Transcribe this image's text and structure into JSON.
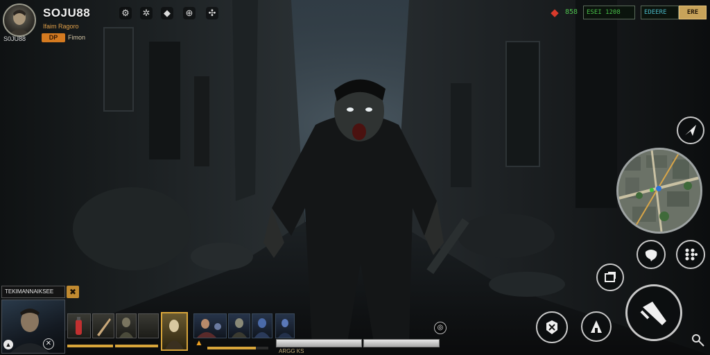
{
  "player": {
    "name": "SOJU88",
    "tag": "S0JU88",
    "subtitle": "Ifaim Ragoro",
    "badge": "DP",
    "badge_text": "Fimon",
    "avatar_icon": "survivor-portrait"
  },
  "top_icons": [
    "settings-icon",
    "gear-icon",
    "chat-icon",
    "crosshair-icon",
    "inventory-icon"
  ],
  "resources": {
    "icon": "gem-icon",
    "value": "858",
    "status_1": "ESEI 1208",
    "status_2": "EDEERE",
    "status_3": "ERE"
  },
  "team": {
    "label": "TEKIMANNAIKSEE",
    "leader_icon": "survivor-portrait",
    "bottom_label": "ARGG KS"
  },
  "action_buttons": [
    "map-toggle-icon",
    "emote-icon",
    "grid-menu-icon",
    "reload-icon",
    "melee-attack-icon",
    "grenade-icon",
    "crouch-icon",
    "voice-icon"
  ],
  "colors": {
    "accent_gold": "#d8a53a",
    "resource_green": "#49c24a",
    "danger_red": "#d93a2b",
    "badge_orange": "#d47a20"
  },
  "bars": {
    "slot_bar_1": 1.0,
    "slot_bar_2": 1.0,
    "hp_primary": 1.0,
    "hp_secondary": 1.0,
    "team_bar": 0.8
  }
}
